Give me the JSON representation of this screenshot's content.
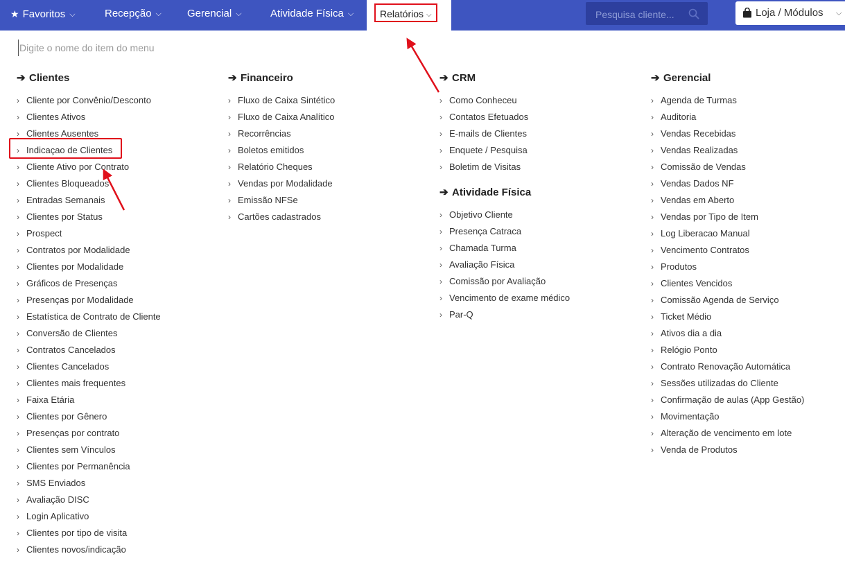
{
  "nav": {
    "favoritos": "Favoritos",
    "recepcao": "Recepção",
    "gerencial": "Gerencial",
    "atividade": "Atividade Física",
    "relatorios": "Relatórios",
    "search_placeholder": "Pesquisa cliente...",
    "loja": "Loja / Módulos"
  },
  "menu_filter_placeholder": "Digite o nome do item do menu",
  "columns": {
    "clientes": {
      "title": "Clientes",
      "items": [
        "Cliente por Convênio/Desconto",
        "Clientes Ativos",
        "Clientes Ausentes",
        "Indicaçao de Clientes",
        "Cliente Ativo por Contrato",
        "Clientes Bloqueados",
        "Entradas Semanais",
        "Clientes por Status",
        "Prospect",
        "Contratos por Modalidade",
        "Clientes por Modalidade",
        "Gráficos de Presenças",
        "Presenças por Modalidade",
        "Estatística de Contrato de Cliente",
        "Conversão de Clientes",
        "Contratos Cancelados",
        "Clientes Cancelados",
        "Clientes mais frequentes",
        "Faixa Etária",
        "Clientes por Gênero",
        "Presenças por contrato",
        "Clientes sem Vínculos",
        "Clientes por Permanência",
        "SMS Enviados",
        "Avaliação DISC",
        "Login Aplicativo",
        "Clientes por tipo de visita",
        "Clientes novos/indicação"
      ]
    },
    "financeiro": {
      "title": "Financeiro",
      "items": [
        "Fluxo de Caixa Sintético",
        "Fluxo de Caixa Analítico",
        "Recorrências",
        "Boletos emitidos",
        "Relatório Cheques",
        "Vendas por Modalidade",
        "Emissão NFSe",
        "Cartões cadastrados"
      ]
    },
    "crm": {
      "title": "CRM",
      "items": [
        "Como Conheceu",
        "Contatos Efetuados",
        "E-mails de Clientes",
        "Enquete / Pesquisa",
        "Boletim de Visitas"
      ]
    },
    "atividade": {
      "title": "Atividade Física",
      "items": [
        "Objetivo Cliente",
        "Presença Catraca",
        "Chamada Turma",
        "Avaliação Física",
        "Comissão por Avaliação",
        "Vencimento de exame médico",
        "Par-Q"
      ]
    },
    "gerencial": {
      "title": "Gerencial",
      "items": [
        "Agenda de Turmas",
        "Auditoria",
        "Vendas Recebidas",
        "Vendas Realizadas",
        "Comissão de Vendas",
        "Vendas Dados NF",
        "Vendas em Aberto",
        "Vendas por Tipo de Item",
        "Log Liberacao Manual",
        "Vencimento Contratos",
        "Produtos",
        "Clientes Vencidos",
        "Comissão Agenda de Serviço",
        "Ticket Médio",
        "Ativos dia a dia",
        "Relógio Ponto",
        "Contrato Renovação Automática",
        "Sessões utilizadas do Cliente",
        "Confirmação de aulas (App Gestão)",
        "Movimentação",
        "Alteração de vencimento em lote",
        "Venda de Produtos"
      ]
    }
  },
  "colors": {
    "nav_bg": "#3e55c0",
    "search_bg": "#2d3f9e",
    "highlight_red": "#e0101b"
  }
}
